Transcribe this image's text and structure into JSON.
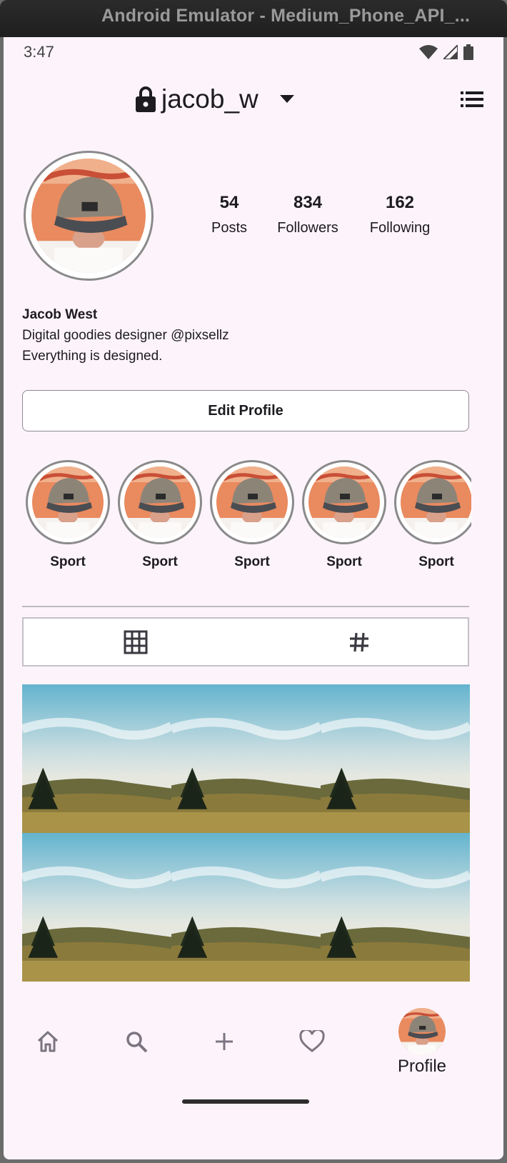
{
  "window": {
    "title": "Android Emulator - Medium_Phone_API_..."
  },
  "status_bar": {
    "time": "3:47"
  },
  "header": {
    "username": "jacob_w"
  },
  "profile": {
    "stats": [
      {
        "value": "54",
        "label": "Posts"
      },
      {
        "value": "834",
        "label": "Followers"
      },
      {
        "value": "162",
        "label": "Following"
      }
    ],
    "name": "Jacob West",
    "bio_line_1": "Digital goodies designer @pixsellz",
    "bio_line_2": "Everything is designed.",
    "edit_button": "Edit Profile"
  },
  "highlights": [
    {
      "label": "Sport"
    },
    {
      "label": "Sport"
    },
    {
      "label": "Sport"
    },
    {
      "label": "Sport"
    },
    {
      "label": "Sport"
    }
  ],
  "tabs": [
    {
      "icon": "grid-icon",
      "selected": true
    },
    {
      "icon": "hashtag-icon",
      "selected": false
    }
  ],
  "bottom_nav": {
    "items": [
      "home-icon",
      "search-icon",
      "add-icon",
      "heart-icon",
      "profile-avatar"
    ],
    "profile_label": "Profile"
  },
  "colors": {
    "screen_background": "#fdf4fb",
    "text": "#1d1b20",
    "nav_icon": "#7a7580"
  }
}
